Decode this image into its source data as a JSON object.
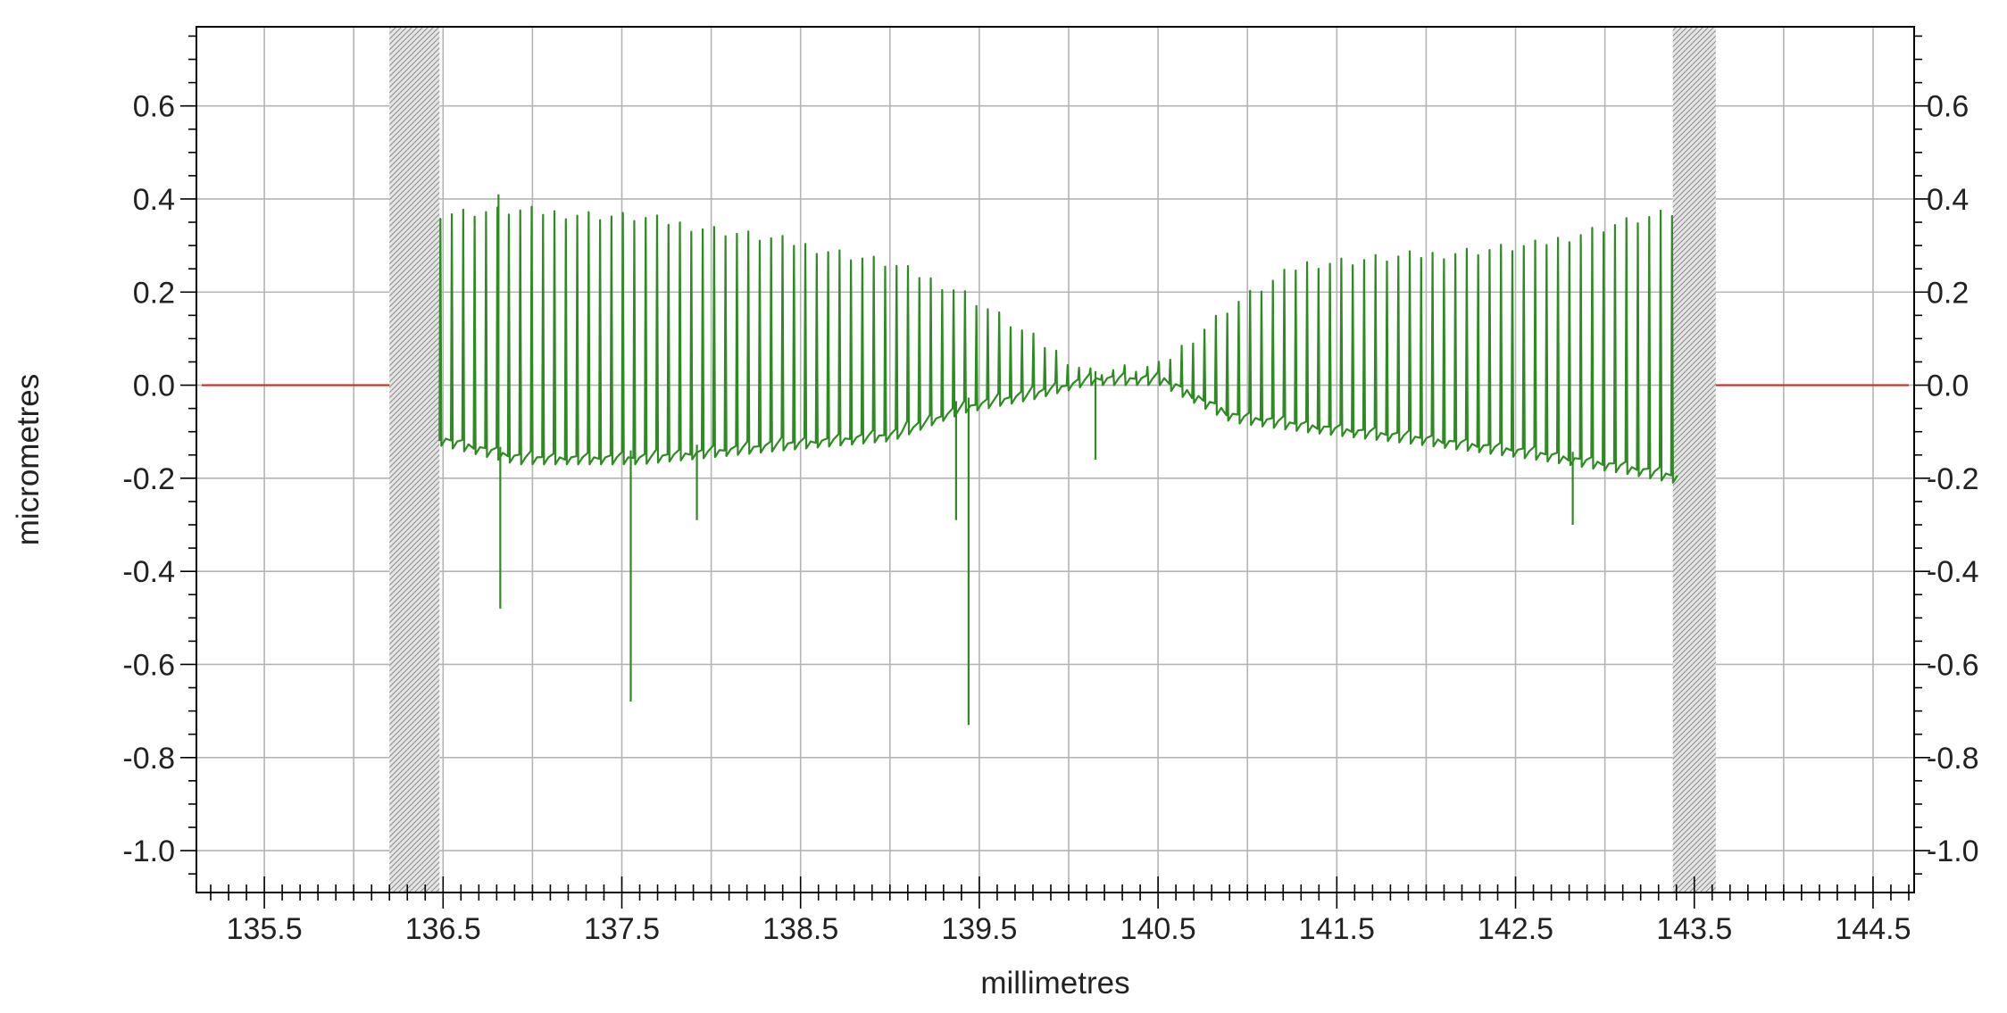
{
  "chart_data": {
    "type": "line",
    "title": "",
    "xlabel": "millimetres",
    "ylabel": "micrometres",
    "xlim": [
      135.12,
      144.73
    ],
    "ylim": [
      -1.09,
      0.77
    ],
    "x_ticks": [
      135.5,
      136.5,
      137.5,
      138.5,
      139.5,
      140.5,
      141.5,
      142.5,
      143.5,
      144.5
    ],
    "x_tick_labels": [
      "135.5",
      "136.5",
      "137.5",
      "138.5",
      "139.5",
      "140.5",
      "141.5",
      "142.5",
      "143.5",
      "144.5"
    ],
    "y_ticks": [
      0.6,
      0.4,
      0.2,
      0.0,
      -0.2,
      -0.4,
      -0.6,
      -0.8,
      -1.0
    ],
    "y_tick_labels": [
      "0.6",
      "0.4",
      "0.2",
      "0.0",
      "-0.2",
      "-0.4",
      "-0.6",
      "-0.8",
      "-1.0"
    ],
    "grid": true,
    "masked_regions": [
      [
        136.2,
        136.48
      ],
      [
        143.38,
        143.62
      ]
    ],
    "reference_line": {
      "y": 0.0,
      "color": "#cc2a1a",
      "segments": [
        [
          135.15,
          136.2
        ],
        [
          143.62,
          144.7
        ]
      ]
    },
    "profile": {
      "name": "",
      "color": "#2e8b22",
      "x_start": 136.48,
      "x_end": 143.38,
      "peak_spacing": 0.0638,
      "envelope": {
        "x": [
          136.48,
          136.9,
          137.6,
          138.4,
          139.0,
          139.4,
          139.8,
          140.1,
          140.5,
          140.9,
          141.3,
          142.0,
          142.6,
          143.1,
          143.38
        ],
        "top": [
          0.37,
          0.375,
          0.36,
          0.31,
          0.26,
          0.2,
          0.1,
          0.03,
          0.04,
          0.17,
          0.26,
          0.28,
          0.3,
          0.35,
          0.37
        ],
        "bottom": [
          -0.13,
          -0.17,
          -0.17,
          -0.14,
          -0.12,
          -0.06,
          -0.03,
          0.0,
          0.0,
          -0.08,
          -0.1,
          -0.13,
          -0.16,
          -0.19,
          -0.21
        ]
      },
      "spikes": [
        {
          "x": 136.81,
          "y": 0.41
        },
        {
          "x": 136.82,
          "y": -0.48
        },
        {
          "x": 137.55,
          "y": -0.68
        },
        {
          "x": 137.92,
          "y": -0.29
        },
        {
          "x": 139.37,
          "y": -0.29
        },
        {
          "x": 139.44,
          "y": -0.73
        },
        {
          "x": 140.15,
          "y": -0.16
        },
        {
          "x": 142.82,
          "y": -0.3
        }
      ]
    }
  }
}
